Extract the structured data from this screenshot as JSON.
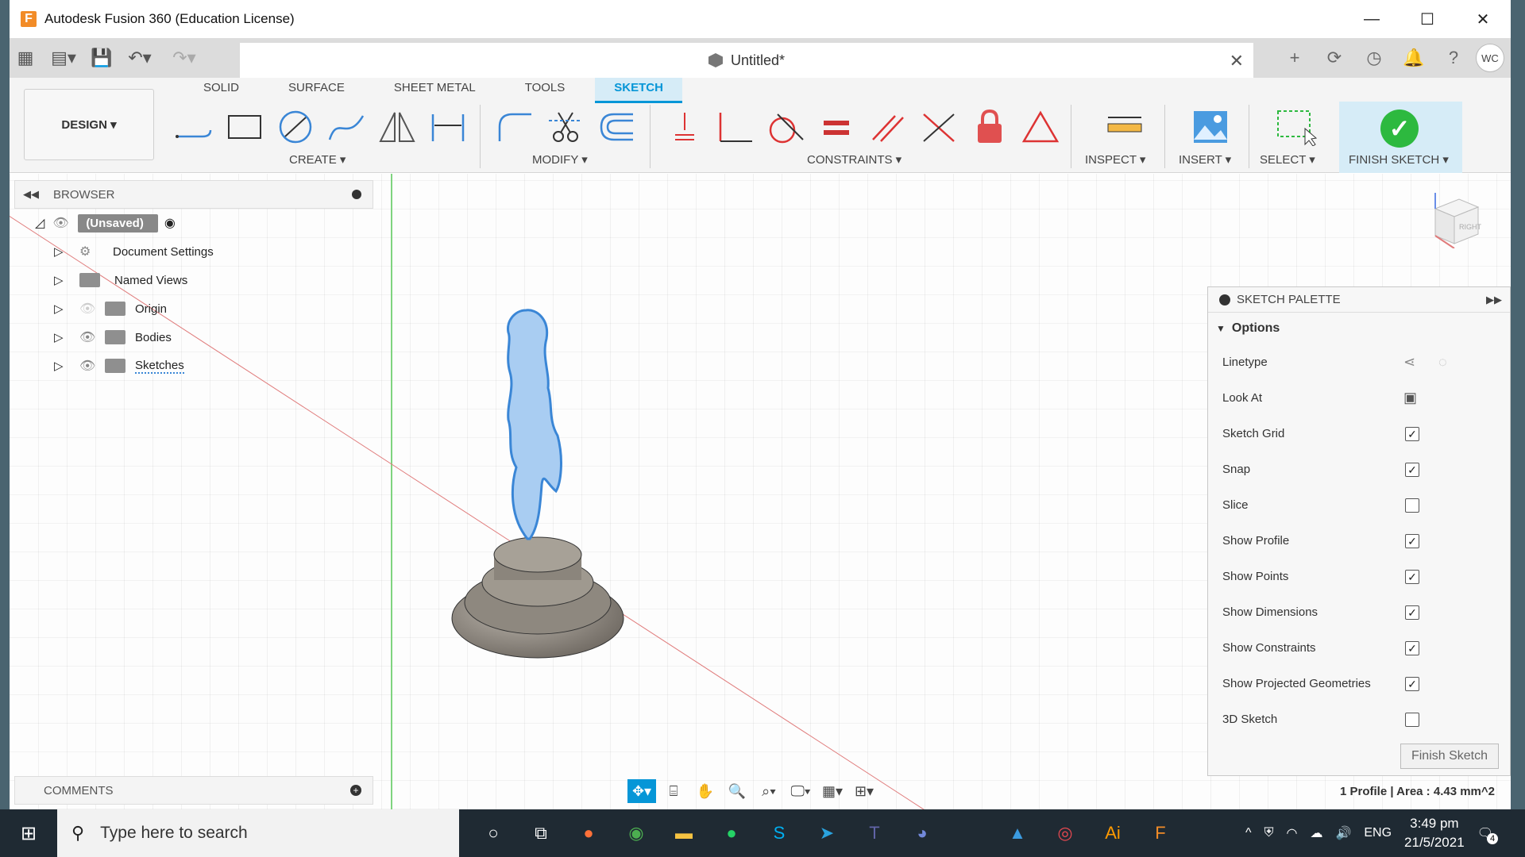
{
  "window": {
    "title": "Autodesk Fusion 360 (Education License)",
    "logo": "F"
  },
  "document_tab": {
    "title": "Untitled*"
  },
  "user_initials": "WC",
  "workspace": {
    "label": "DESIGN ▾"
  },
  "ribbon_tabs": [
    "SOLID",
    "SURFACE",
    "SHEET METAL",
    "TOOLS",
    "SKETCH"
  ],
  "groups": {
    "create": "CREATE ▾",
    "modify": "MODIFY ▾",
    "constraints": "CONSTRAINTS ▾",
    "inspect": "INSPECT ▾",
    "insert": "INSERT ▾",
    "select": "SELECT ▾",
    "finish": "FINISH SKETCH ▾"
  },
  "browser": {
    "title": "BROWSER",
    "root": "(Unsaved)",
    "items": [
      "Document Settings",
      "Named Views",
      "Origin",
      "Bodies",
      "Sketches"
    ]
  },
  "comments": {
    "title": "COMMENTS"
  },
  "viewcube": {
    "label": "RIGHT"
  },
  "palette": {
    "title": "SKETCH PALETTE",
    "section": "Options",
    "rows": [
      {
        "label": "Linetype",
        "kind": "icons"
      },
      {
        "label": "Look At",
        "kind": "icon"
      },
      {
        "label": "Sketch Grid",
        "checked": true
      },
      {
        "label": "Snap",
        "checked": true
      },
      {
        "label": "Slice",
        "checked": false
      },
      {
        "label": "Show Profile",
        "checked": true
      },
      {
        "label": "Show Points",
        "checked": true
      },
      {
        "label": "Show Dimensions",
        "checked": true
      },
      {
        "label": "Show Constraints",
        "checked": true
      },
      {
        "label": "Show Projected Geometries",
        "checked": true
      },
      {
        "label": "3D Sketch",
        "checked": false
      }
    ],
    "finish_button": "Finish Sketch"
  },
  "status": {
    "text": "1 Profile | Area : 4.43 mm^2"
  },
  "taskbar": {
    "search_placeholder": "Type here to search",
    "lang": "ENG",
    "time": "3:49 pm",
    "date": "21/5/2021",
    "notifications": "4"
  },
  "colors": {
    "accent": "#0696d7",
    "finish_green": "#2db93f",
    "sketch_fill": "#a9cdf2",
    "sketch_stroke": "#3a86d6"
  }
}
